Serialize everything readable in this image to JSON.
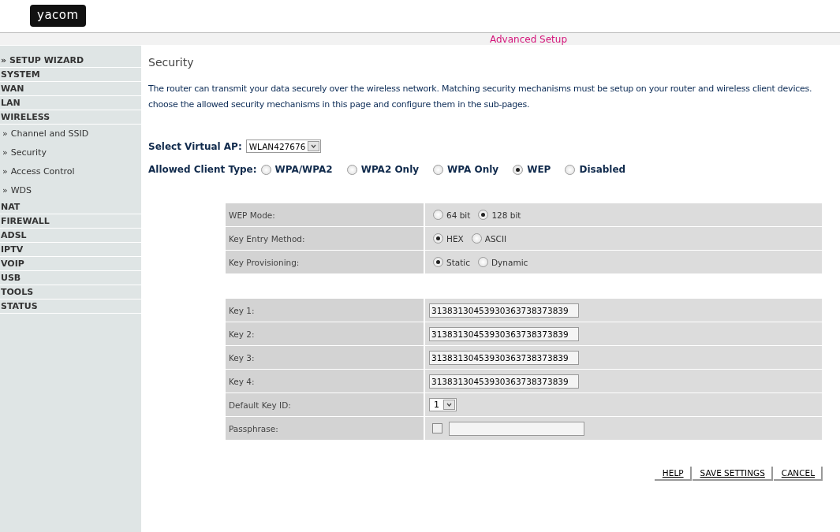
{
  "logo": "yacom",
  "top_bar": {
    "title": "Advanced Setup"
  },
  "sidebar": {
    "items": [
      {
        "label": "» SETUP WIZARD",
        "kind": "section"
      },
      {
        "label": "SYSTEM",
        "kind": "section"
      },
      {
        "label": "WAN",
        "kind": "section"
      },
      {
        "label": "LAN",
        "kind": "section"
      },
      {
        "label": "WIRELESS",
        "kind": "section"
      },
      {
        "label": "Channel and SSID",
        "kind": "sub",
        "marker": "»"
      },
      {
        "label": "Security",
        "kind": "sub",
        "marker": "»"
      },
      {
        "label": "Access Control",
        "kind": "sub",
        "marker": "»"
      },
      {
        "label": "WDS",
        "kind": "sub",
        "marker": "»"
      },
      {
        "label": "NAT",
        "kind": "section"
      },
      {
        "label": "FIREWALL",
        "kind": "section"
      },
      {
        "label": "ADSL",
        "kind": "section"
      },
      {
        "label": "IPTV",
        "kind": "section"
      },
      {
        "label": "VOIP",
        "kind": "section"
      },
      {
        "label": "USB",
        "kind": "section"
      },
      {
        "label": "TOOLS",
        "kind": "section"
      },
      {
        "label": "STATUS",
        "kind": "section"
      }
    ]
  },
  "main": {
    "title": "Security",
    "description": [
      "The router can transmit your data securely over the wireless network. Matching security mechanisms must be setup on your router and wireless client devices.",
      "choose the allowed security mechanisms in this page and configure them in the sub-pages."
    ],
    "virtual_ap": {
      "label": "Select Virtual AP:",
      "value": "WLAN427676"
    },
    "client_type": {
      "label": "Allowed Client Type:",
      "options": [
        {
          "label": "WPA/WPA2",
          "selected": false
        },
        {
          "label": "WPA2 Only",
          "selected": false
        },
        {
          "label": "WPA Only",
          "selected": false
        },
        {
          "label": "WEP",
          "selected": true
        },
        {
          "label": "Disabled",
          "selected": false
        }
      ]
    },
    "wep_settings": [
      {
        "label": "WEP Mode:",
        "kind": "radio",
        "options": [
          {
            "label": "64 bit",
            "selected": false
          },
          {
            "label": "128 bit",
            "selected": true
          }
        ]
      },
      {
        "label": "Key Entry Method:",
        "kind": "radio",
        "options": [
          {
            "label": "HEX",
            "selected": true
          },
          {
            "label": "ASCII",
            "selected": false
          }
        ]
      },
      {
        "label": "Key Provisioning:",
        "kind": "radio",
        "options": [
          {
            "label": "Static",
            "selected": true
          },
          {
            "label": "Dynamic",
            "selected": false
          }
        ]
      }
    ],
    "keys": [
      {
        "label": "Key 1:",
        "kind": "text",
        "value": "31383130453930363738373839"
      },
      {
        "label": "Key 2:",
        "kind": "text",
        "value": "31383130453930363738373839"
      },
      {
        "label": "Key 3:",
        "kind": "text",
        "value": "31383130453930363738373839"
      },
      {
        "label": "Key 4:",
        "kind": "text",
        "value": "31383130453930363738373839"
      },
      {
        "label": "Default Key ID:",
        "kind": "select",
        "value": "1"
      },
      {
        "label": "Passphrase:",
        "kind": "passphrase",
        "checked": false
      }
    ],
    "buttons": [
      "HELP",
      "SAVE SETTINGS",
      "CANCEL"
    ]
  }
}
